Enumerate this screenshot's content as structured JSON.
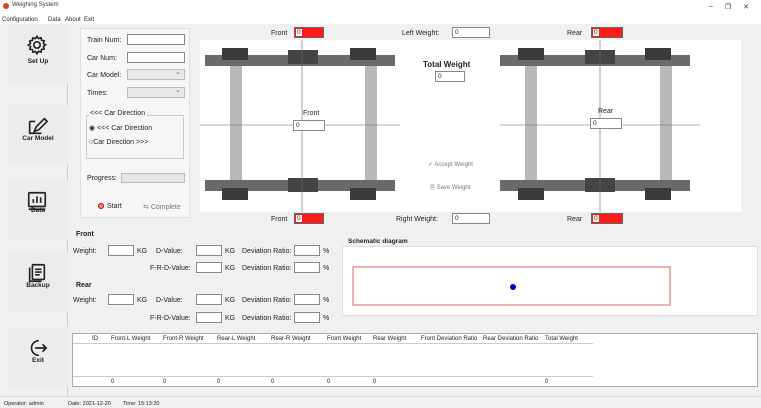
{
  "window": {
    "title": "Weighing System",
    "min_icon": "–",
    "max_icon": "❐",
    "close_icon": "✕"
  },
  "menu": [
    "Configuration",
    "Data",
    "About",
    "Exit"
  ],
  "sidebar": [
    {
      "label": "Set Up",
      "icon": "gear-icon"
    },
    {
      "label": "Car Model",
      "icon": "edit-icon"
    },
    {
      "label": "Data",
      "icon": "chart-icon"
    },
    {
      "label": "Backup",
      "icon": "documents-icon"
    },
    {
      "label": "Exit",
      "icon": "exit-icon"
    }
  ],
  "form": {
    "train_num_label": "Train Num:",
    "train_num_value": "",
    "car_num_label": "Car Num:",
    "car_num_value": "",
    "car_model_label": "Car Model:",
    "car_model_value": "",
    "times_label": "Times:",
    "times_value": "",
    "direction_title": "<<< Car Direction",
    "direction_opt1": "<<< Car Direction",
    "direction_opt2": "Car Direction >>>",
    "progress_label": "Progress:",
    "start_label": "Start",
    "complete_label": "Complete"
  },
  "top": {
    "front_label": "Front",
    "front_value": "0",
    "left_weight_label": "Left Weight:",
    "left_weight_value": "0",
    "rear_label": "Rear",
    "rear_value": "0",
    "total_weight_label": "Total Weight",
    "total_weight_value": "0",
    "center_front_label": "Front",
    "center_front_value": "0",
    "center_rear_label": "Rear",
    "center_rear_value": "0",
    "accept_weight": "Accept Weight",
    "save_weight": "Save Weight"
  },
  "bottom": {
    "front_label": "Front",
    "front_value": "0",
    "right_weight_label": "Right Weight:",
    "right_weight_value": "0",
    "rear_label": "Rear",
    "rear_value": "0"
  },
  "front_section": {
    "title": "Front",
    "weight_label": "Weight:",
    "weight_value": "",
    "weight_unit": "KG",
    "dvalue_label": "D-Value:",
    "dvalue_value": "",
    "dvalue_unit": "KG",
    "dev_ratio_label": "Deviation Ratio:",
    "dev_ratio_value": "",
    "dev_ratio_unit": "%",
    "frd_label": "F-R-D-Value:",
    "frd_value": "",
    "frd_unit": "KG",
    "dev_ratio2_label": "Deviation Ratio:",
    "dev_ratio2_value": "",
    "dev_ratio2_unit": "%"
  },
  "rear_section": {
    "title": "Rear",
    "weight_label": "Weight:",
    "weight_value": "",
    "weight_unit": "KG",
    "dvalue_label": "D-Value:",
    "dvalue_value": "",
    "dvalue_unit": "KG",
    "dev_ratio_label": "Deviation Ratio:",
    "dev_ratio_value": "",
    "dev_ratio_unit": "%",
    "frd_label": "F-R-D-Value:",
    "frd_value": "",
    "frd_unit": "KG",
    "dev_ratio2_label": "Deviation Ratio:",
    "dev_ratio2_value": "",
    "dev_ratio2_unit": "%"
  },
  "schematic": {
    "title": "Schematic diagram"
  },
  "table": {
    "columns": [
      "ID",
      "Front-L Weight",
      "Front-R Weight",
      "Rear-L Weight",
      "Rear-R Weight",
      "Front Weight",
      "Rear Weight",
      "Front Deviation Ratio",
      "Rear Deviation Ratio",
      "Total Weight"
    ],
    "summary": [
      "",
      "0",
      "0",
      "0",
      "0",
      "0",
      "0",
      "",
      "",
      "0"
    ]
  },
  "status": {
    "operator": "Operator: admin",
    "date": "Date: 2021-12-20",
    "time": "Time: 15:13:20"
  },
  "colors": {
    "alarm_red": "#ff1a1a",
    "dot_blue": "#0000cc",
    "rect_red": "#d04040"
  }
}
